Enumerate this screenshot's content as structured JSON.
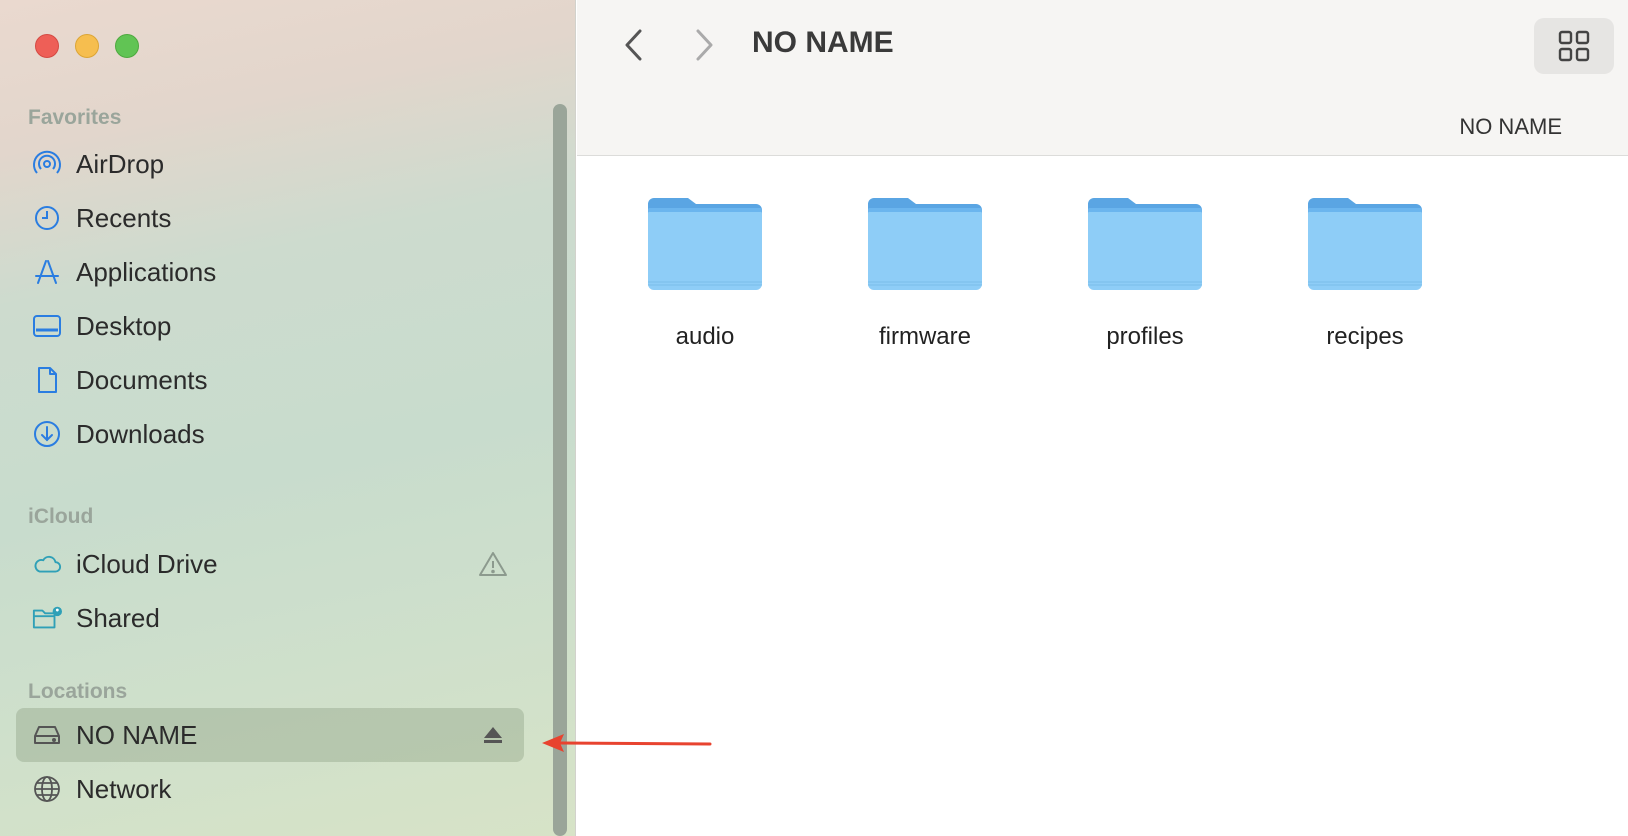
{
  "window": {
    "title": "NO NAME",
    "path_label": "NO NAME"
  },
  "sidebar": {
    "sections": {
      "favorites": "Favorites",
      "icloud": "iCloud",
      "locations": "Locations"
    },
    "favorites": [
      {
        "label": "AirDrop",
        "icon": "airdrop-icon"
      },
      {
        "label": "Recents",
        "icon": "clock-icon"
      },
      {
        "label": "Applications",
        "icon": "applications-icon"
      },
      {
        "label": "Desktop",
        "icon": "desktop-icon"
      },
      {
        "label": "Documents",
        "icon": "document-icon"
      },
      {
        "label": "Downloads",
        "icon": "download-icon"
      }
    ],
    "icloud": [
      {
        "label": "iCloud Drive",
        "icon": "cloud-icon",
        "accessory": "warning-icon"
      },
      {
        "label": "Shared",
        "icon": "shared-folder-icon"
      }
    ],
    "locations": [
      {
        "label": "NO NAME",
        "icon": "drive-icon",
        "accessory": "eject-icon",
        "selected": true
      },
      {
        "label": "Network",
        "icon": "globe-icon"
      }
    ]
  },
  "folders": [
    {
      "name": "audio"
    },
    {
      "name": "firmware"
    },
    {
      "name": "profiles"
    },
    {
      "name": "recipes"
    }
  ],
  "colors": {
    "accent_icon": "#2a7de1",
    "folder_top": "#5aa5e3",
    "folder_body": "#8ecdf7",
    "annotation_arrow": "#e8432f"
  }
}
